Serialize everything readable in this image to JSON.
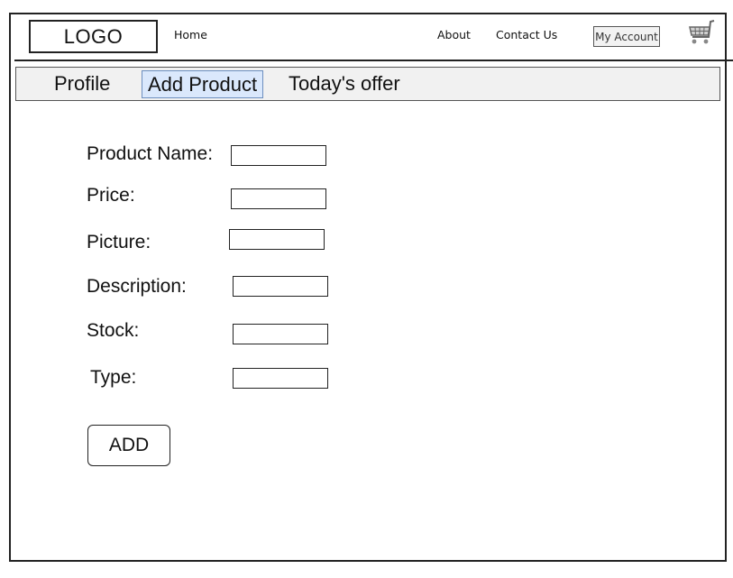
{
  "header": {
    "logo": "LOGO",
    "nav": {
      "home": "Home",
      "about": "About",
      "contact": "Contact Us",
      "account": "My Account"
    },
    "cart_icon": "shopping-cart-icon"
  },
  "tabs": [
    {
      "label": "Profile",
      "active": false
    },
    {
      "label": "Add Product",
      "active": true
    },
    {
      "label": "Today's offer",
      "active": false
    }
  ],
  "form": {
    "fields": [
      {
        "label": "Product Name:",
        "value": ""
      },
      {
        "label": "Price:",
        "value": ""
      },
      {
        "label": "Picture:",
        "value": ""
      },
      {
        "label": "Description:",
        "value": ""
      },
      {
        "label": "Stock:",
        "value": ""
      },
      {
        "label": "Type:",
        "value": ""
      }
    ],
    "submit": "ADD"
  },
  "colors": {
    "active_tab_bg": "#dae8fc",
    "active_tab_border": "#6c8ebf",
    "tabbar_bg": "#f1f1f1"
  }
}
